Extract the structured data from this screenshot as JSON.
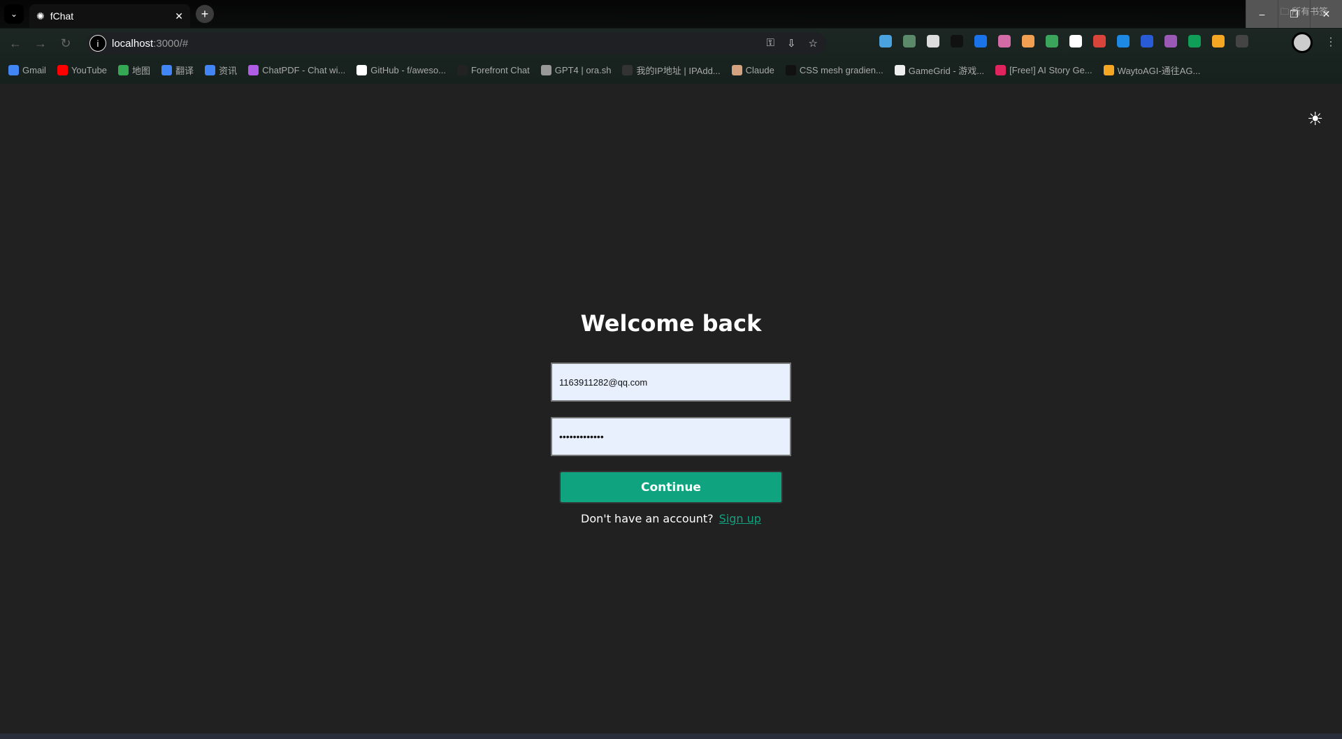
{
  "browser": {
    "tab_title": "fChat",
    "url_host": "localhost",
    "url_rest": ":3000/#",
    "bookmarks": [
      {
        "label": "Gmail",
        "color": "#4285f4"
      },
      {
        "label": "YouTube",
        "color": "#ff0000"
      },
      {
        "label": "地图",
        "color": "#34a853"
      },
      {
        "label": "翻译",
        "color": "#4285f4"
      },
      {
        "label": "资讯",
        "color": "#4285f4"
      },
      {
        "label": "ChatPDF - Chat wi...",
        "color": "#b05ce6"
      },
      {
        "label": "GitHub - f/aweso...",
        "color": "#ffffff"
      },
      {
        "label": "Forefront Chat",
        "color": "#222222"
      },
      {
        "label": "GPT4 | ora.sh",
        "color": "#999999"
      },
      {
        "label": "我的IP地址 | IPAdd...",
        "color": "#333333"
      },
      {
        "label": "Claude",
        "color": "#d4a27f"
      },
      {
        "label": "CSS mesh gradien...",
        "color": "#111111"
      },
      {
        "label": "GameGrid - 游戏...",
        "color": "#eeeeee"
      },
      {
        "label": "[Free!] AI Story Ge...",
        "color": "#e0245e"
      },
      {
        "label": "WaytoAGI-通往AG...",
        "color": "#f5a623"
      }
    ],
    "all_bookmarks": "所有书签",
    "extension_colors": [
      "#4aa3df",
      "#5a8a6a",
      "#dddddd",
      "#111111",
      "#1a73e8",
      "#d36ba6",
      "#f0a050",
      "#3ba55c",
      "#ffffff",
      "#d9453b",
      "#1e88e5",
      "#2a5bd7",
      "#9b59b6",
      "#0f9d58",
      "#f5a623",
      "#444444"
    ]
  },
  "login": {
    "title": "Welcome back",
    "email_value": "1163911282@qq.com",
    "password_mask": "•••••••••••••",
    "continue_label": "Continue",
    "no_account_text": "Don't have an account?",
    "signup_label": "Sign up"
  },
  "colors": {
    "accent": "#10a37f",
    "background": "#212121",
    "input_bg": "#e8f0fe"
  }
}
